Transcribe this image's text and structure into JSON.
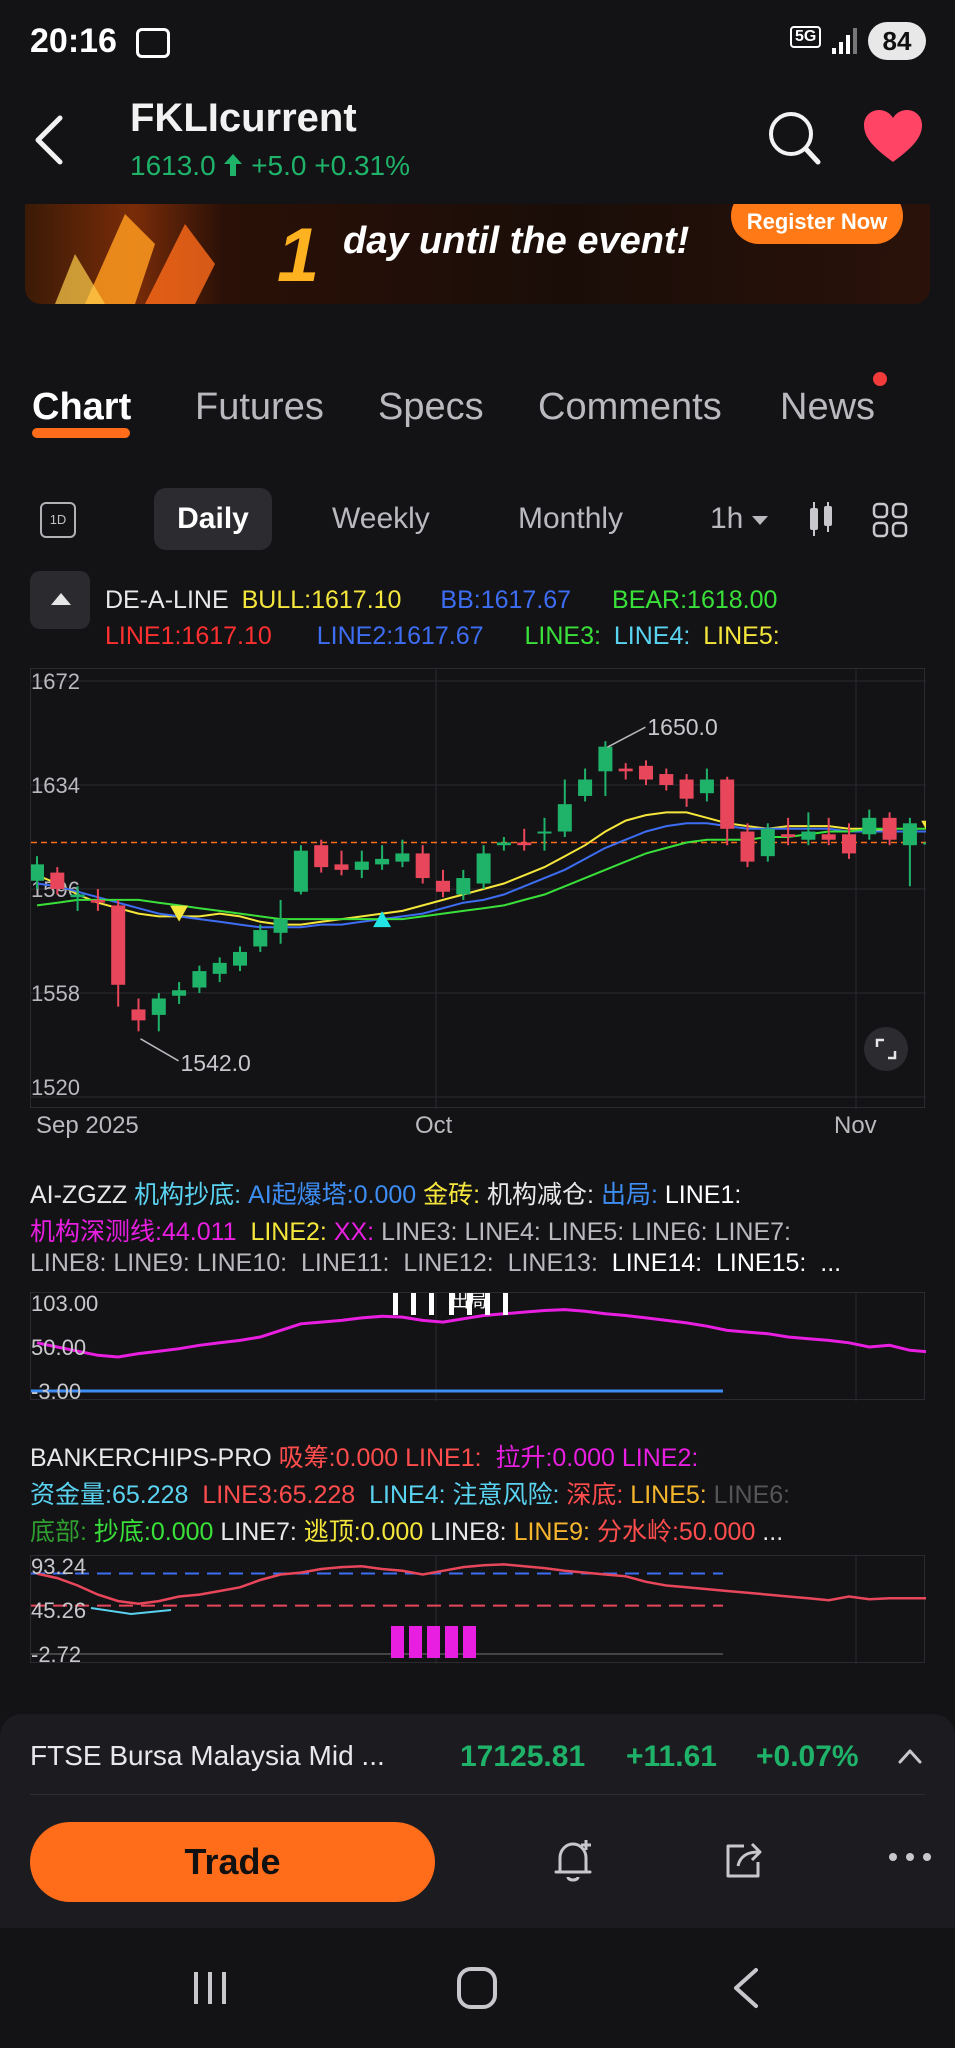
{
  "status": {
    "time": "20:16",
    "network": "5G",
    "battery": "84"
  },
  "header": {
    "title": "FKLIcurrent",
    "price": "1613.0",
    "change": "+5.0",
    "change_pct": "+0.31%"
  },
  "banner": {
    "number": "1",
    "text": "day until the event!",
    "register_label": "Register Now"
  },
  "tabs": [
    "Chart",
    "Futures",
    "Specs",
    "Comments",
    "News"
  ],
  "periods": {
    "icon_label": "1D",
    "daily": "Daily",
    "weekly": "Weekly",
    "monthly": "Monthly",
    "hour": "1h"
  },
  "legend": {
    "name": "DE-A-LINE",
    "bull": "BULL:1617.10",
    "bb": "BB:1617.67",
    "bear": "BEAR:1618.00",
    "line1": "LINE1:1617.10",
    "line2": "LINE2:1617.67",
    "line3": "LINE3:",
    "line4": "LINE4:",
    "line5": "LINE5:"
  },
  "colors": {
    "up": "#1fb36a",
    "down": "#e8465a",
    "accent": "#ff6c1a",
    "yellow": "#f5e63c",
    "blue": "#3d6df2",
    "green": "#3ae03a",
    "magenta": "#e81ee0"
  },
  "chart_data": {
    "type": "candlestick",
    "y_ticks": [
      "1672",
      "1634",
      "1596",
      "1558",
      "1520"
    ],
    "ylim": [
      1520,
      1672
    ],
    "x_labels": [
      "Sep 2025",
      "Oct",
      "Nov"
    ],
    "annotations": [
      "1650.0",
      "1542.0"
    ],
    "last_price": 1613.0,
    "candles": [
      [
        1599,
        1605,
        1596,
        1608
      ],
      [
        1602,
        1596,
        1594,
        1604
      ],
      [
        1593,
        1594,
        1588,
        1597
      ],
      [
        1592,
        1591,
        1588,
        1596
      ],
      [
        1590,
        1561,
        1553,
        1592
      ],
      [
        1552,
        1548,
        1544,
        1556
      ],
      [
        1550,
        1556,
        1544,
        1558
      ],
      [
        1557,
        1559,
        1554,
        1562
      ],
      [
        1560,
        1566,
        1558,
        1568
      ],
      [
        1565,
        1569,
        1562,
        1571
      ],
      [
        1568,
        1573,
        1566,
        1575
      ],
      [
        1575,
        1581,
        1573,
        1583
      ],
      [
        1580,
        1585,
        1576,
        1592
      ],
      [
        1595,
        1610,
        1594,
        1612
      ],
      [
        1612,
        1604,
        1602,
        1614
      ],
      [
        1605,
        1603,
        1601,
        1610
      ],
      [
        1603,
        1606,
        1600,
        1610
      ],
      [
        1605,
        1607,
        1603,
        1612
      ],
      [
        1606,
        1609,
        1604,
        1614
      ],
      [
        1609,
        1600,
        1598,
        1612
      ],
      [
        1599,
        1595,
        1593,
        1603
      ],
      [
        1594,
        1600,
        1592,
        1603
      ],
      [
        1598,
        1609,
        1596,
        1612
      ],
      [
        1612,
        1613,
        1610,
        1615
      ],
      [
        1613,
        1612,
        1610,
        1618
      ],
      [
        1617,
        1617,
        1610,
        1622
      ],
      [
        1617,
        1627,
        1615,
        1636
      ],
      [
        1630,
        1636,
        1628,
        1640
      ],
      [
        1639,
        1648,
        1630,
        1650
      ],
      [
        1640,
        1639,
        1636,
        1642
      ],
      [
        1641,
        1636,
        1634,
        1643
      ],
      [
        1638,
        1634,
        1632,
        1640
      ],
      [
        1636,
        1629,
        1626,
        1638
      ],
      [
        1631,
        1636,
        1628,
        1640
      ],
      [
        1636,
        1618,
        1612,
        1637
      ],
      [
        1617,
        1606,
        1604,
        1620
      ],
      [
        1608,
        1618,
        1606,
        1620
      ],
      [
        1616,
        1615,
        1612,
        1622
      ],
      [
        1614,
        1617,
        1612,
        1624
      ],
      [
        1616,
        1614,
        1612,
        1622
      ],
      [
        1616,
        1609,
        1607,
        1620
      ],
      [
        1616,
        1622,
        1614,
        1625
      ],
      [
        1622,
        1614,
        1612,
        1624
      ],
      [
        1612,
        1620,
        1597,
        1622
      ],
      [
        1613,
        1613,
        1610,
        1616
      ]
    ],
    "x_positions": [
      0,
      1,
      2,
      3,
      4,
      5,
      6,
      7,
      8,
      9,
      10,
      11,
      12,
      13,
      14,
      15,
      16,
      17,
      18,
      19,
      20,
      21,
      22,
      23,
      24,
      25,
      26,
      27,
      28,
      29,
      30,
      31,
      32,
      33,
      34,
      35,
      36,
      37,
      38,
      39,
      40,
      41,
      42,
      43,
      44
    ],
    "lines": {
      "yellow": [
        1601,
        1598,
        1594,
        1591,
        1589,
        1587,
        1586,
        1586,
        1586,
        1587,
        1586,
        1584,
        1583,
        1583,
        1584,
        1585,
        1586,
        1587,
        1588,
        1590,
        1592,
        1594,
        1596,
        1598,
        1601,
        1604,
        1608,
        1612,
        1617,
        1621,
        1623,
        1624,
        1624,
        1622,
        1620,
        1619,
        1618,
        1619,
        1619,
        1619,
        1618,
        1618,
        1617,
        1617,
        1617
      ],
      "blue": [
        1598,
        1597,
        1595,
        1593,
        1591,
        1589,
        1587,
        1586,
        1585,
        1584,
        1583,
        1582,
        1582,
        1582,
        1583,
        1583,
        1584,
        1585,
        1586,
        1587,
        1589,
        1591,
        1592,
        1594,
        1597,
        1600,
        1603,
        1607,
        1611,
        1614,
        1617,
        1619,
        1620,
        1620,
        1619,
        1618,
        1618,
        1618,
        1618,
        1618,
        1617,
        1617,
        1617,
        1617,
        1617
      ],
      "green": [
        1590,
        1591,
        1592,
        1592,
        1592,
        1592,
        1591,
        1590,
        1589,
        1588,
        1587,
        1586,
        1585,
        1585,
        1585,
        1585,
        1585,
        1585,
        1585,
        1586,
        1587,
        1588,
        1589,
        1590,
        1592,
        1594,
        1597,
        1600,
        1603,
        1606,
        1609,
        1611,
        1613,
        1614,
        1614,
        1614,
        1615,
        1615,
        1616,
        1617,
        1617,
        1618,
        1618,
        1618,
        1618
      ]
    },
    "markers": [
      {
        "x": 7,
        "y": 1587,
        "color": "yellow",
        "dir": "down"
      },
      {
        "x": 17,
        "y": 1585,
        "color": "cyan",
        "dir": "up"
      },
      {
        "x": 44,
        "y": 1618,
        "color": "yellow",
        "dir": "down"
      }
    ]
  },
  "ind1": {
    "row1": [
      {
        "t": "AI-ZGZZ ",
        "c": "#e8e8ea"
      },
      {
        "t": "机构抄底: ",
        "c": "#5ad3f0"
      },
      {
        "t": "AI起爆塔:0.000 ",
        "c": "#3d8df2"
      },
      {
        "t": "金砖: ",
        "c": "#f5e63c"
      },
      {
        "t": "机构减仓: ",
        "c": "#e8e8ea"
      },
      {
        "t": "出局: ",
        "c": "#3d8df2"
      },
      {
        "t": "LINE1:",
        "c": "#ffffff"
      }
    ],
    "row2": [
      {
        "t": "机构深测线:44.011  ",
        "c": "#e81ee0"
      },
      {
        "t": "LINE2: ",
        "c": "#f5e63c"
      },
      {
        "t": "XX: ",
        "c": "#e81ee0"
      },
      {
        "t": "LINE3: LINE4: LINE5: LINE6: LINE7:",
        "c": "#b9b9be"
      }
    ],
    "row3": [
      {
        "t": "LINE8: LINE9: LINE10:  LINE11:  LINE12:  LINE13:  ",
        "c": "#b9b9be"
      },
      {
        "t": "LINE14:  LINE15:  ...",
        "c": "#ffffff"
      }
    ],
    "y_ticks": [
      "103.00",
      "50.00",
      "-3.00"
    ],
    "label": "出局",
    "values": [
      55,
      50,
      45,
      40,
      38,
      42,
      45,
      48,
      52,
      55,
      58,
      62,
      70,
      78,
      80,
      82,
      85,
      87,
      86,
      82,
      80,
      84,
      88,
      90,
      92,
      94,
      95,
      93,
      90,
      88,
      85,
      82,
      79,
      75,
      70,
      68,
      66,
      62,
      60,
      58,
      55,
      50,
      52,
      46,
      44
    ]
  },
  "ind2": {
    "row1": [
      {
        "t": "BANKERCHIPS-PRO ",
        "c": "#e8e8ea"
      },
      {
        "t": "吸筹:0.000 ",
        "c": "#ff4d4d"
      },
      {
        "t": "LINE1:  ",
        "c": "#ff4d4d"
      },
      {
        "t": "拉升:0.000 ",
        "c": "#e81ee0"
      },
      {
        "t": "LINE2:",
        "c": "#e81ee0"
      }
    ],
    "row2": [
      {
        "t": "资金量:65.228  ",
        "c": "#5ad3f0"
      },
      {
        "t": "LINE3:65.228  ",
        "c": "#ff4d4d"
      },
      {
        "t": "LINE4: ",
        "c": "#5ad3f0"
      },
      {
        "t": "注意风险: ",
        "c": "#5ad3f0"
      },
      {
        "t": "深底: ",
        "c": "#ff4d4d"
      },
      {
        "t": "LINE5: ",
        "c": "#f5b52c"
      },
      {
        "t": "LINE6:",
        "c": "#555558"
      }
    ],
    "row3": [
      {
        "t": "底部: ",
        "c": "#2f9d2f"
      },
      {
        "t": "抄底:0.000 ",
        "c": "#3ae03a"
      },
      {
        "t": "LINE7: ",
        "c": "#e8e8ea"
      },
      {
        "t": "逃顶:0.000 ",
        "c": "#f5e63c"
      },
      {
        "t": "LINE8: ",
        "c": "#e8e8ea"
      },
      {
        "t": "LINE9: ",
        "c": "#f5b52c"
      },
      {
        "t": "分水岭:50.000 ",
        "c": "#ff4d4d"
      },
      {
        "t": "...",
        "c": "#e8e8ea"
      }
    ],
    "y_ticks": [
      "93.24",
      "45.26",
      "-2.72"
    ],
    "values": [
      85,
      80,
      72,
      62,
      55,
      52,
      55,
      60,
      62,
      66,
      70,
      78,
      84,
      86,
      90,
      92,
      93,
      90,
      88,
      84,
      88,
      92,
      94,
      95,
      93,
      91,
      88,
      86,
      84,
      82,
      76,
      72,
      70,
      68,
      66,
      64,
      62,
      60,
      58,
      56,
      60,
      57,
      58,
      58,
      58
    ]
  },
  "bottom": {
    "index_name": "FTSE Bursa Malaysia Mid ...",
    "index_value": "17125.81",
    "index_change": "+11.61",
    "index_pct": "+0.07%",
    "trade_label": "Trade"
  }
}
